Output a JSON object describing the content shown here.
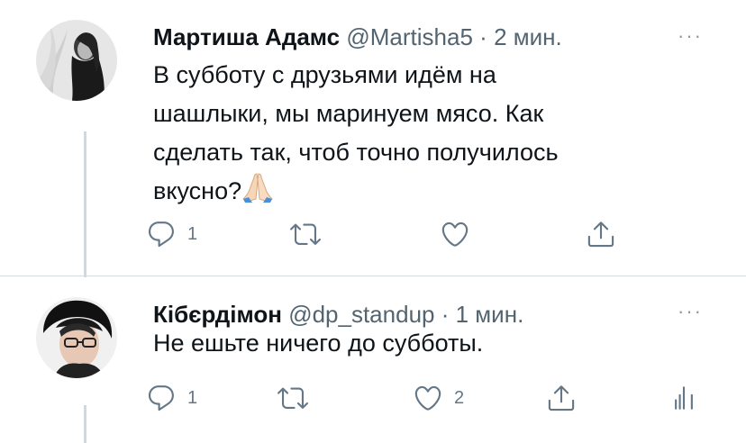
{
  "tweets": [
    {
      "author": "Мартиша Адамс",
      "handle": "@Martisha5",
      "separator": "·",
      "time": "2 мин.",
      "more": "···",
      "text_lines": [
        "В субботу с друзьями идём на",
        "шашлыки, мы маринуем мясо. Как",
        "сделать так, чтоб точно получилось",
        "вкусно?"
      ],
      "emoji": "folded-hands",
      "reply_count": "1",
      "retweet_count": "",
      "like_count": ""
    },
    {
      "author": "Кібєрдімон",
      "handle": "@dp_standup",
      "separator": "·",
      "time": "1 мин.",
      "more": "···",
      "text_lines": [
        "Не ешьте ничего до субботы."
      ],
      "reply_count": "1",
      "retweet_count": "",
      "like_count": "2"
    }
  ],
  "icons": {
    "reply": "reply-icon",
    "retweet": "retweet-icon",
    "like": "heart-icon",
    "share": "share-icon",
    "analytics": "analytics-icon"
  },
  "colors": {
    "text": "#0f1419",
    "secondary": "#536471",
    "icon": "#657786",
    "thread_line": "#cfd9de"
  }
}
